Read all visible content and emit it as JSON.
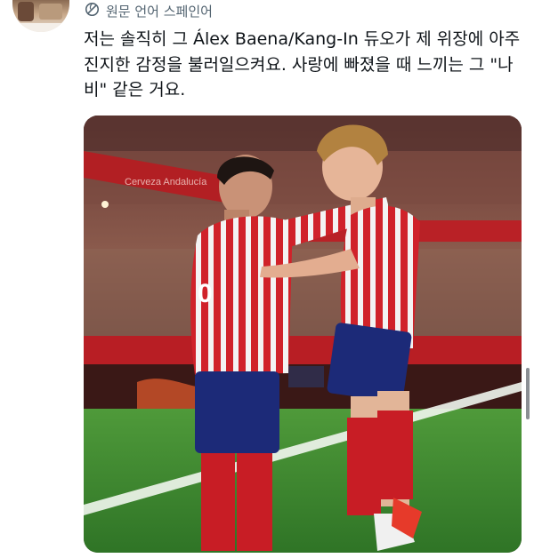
{
  "tweet": {
    "translate_label": "원문 언어 스페인어",
    "translate_icon": "globe-slash-icon",
    "text": "저는 솔직히 그 Álex Baena/Kang-In 듀오가 제 위장에 아주 진지한 감정을 불러일으켜요. 사랑에 빠졌을 때 느끼는 그 \"나비\" 같은 거요.",
    "media": {
      "kind": "photo",
      "sponsor_banner_text": "Cerveza Andalucía"
    }
  },
  "colors": {
    "secondary_text": "#536471",
    "primary_text": "#0f1419",
    "jersey_red": "#d0222a",
    "shorts_blue": "#1c2a78",
    "pitch_green": "#3f8a2e"
  }
}
